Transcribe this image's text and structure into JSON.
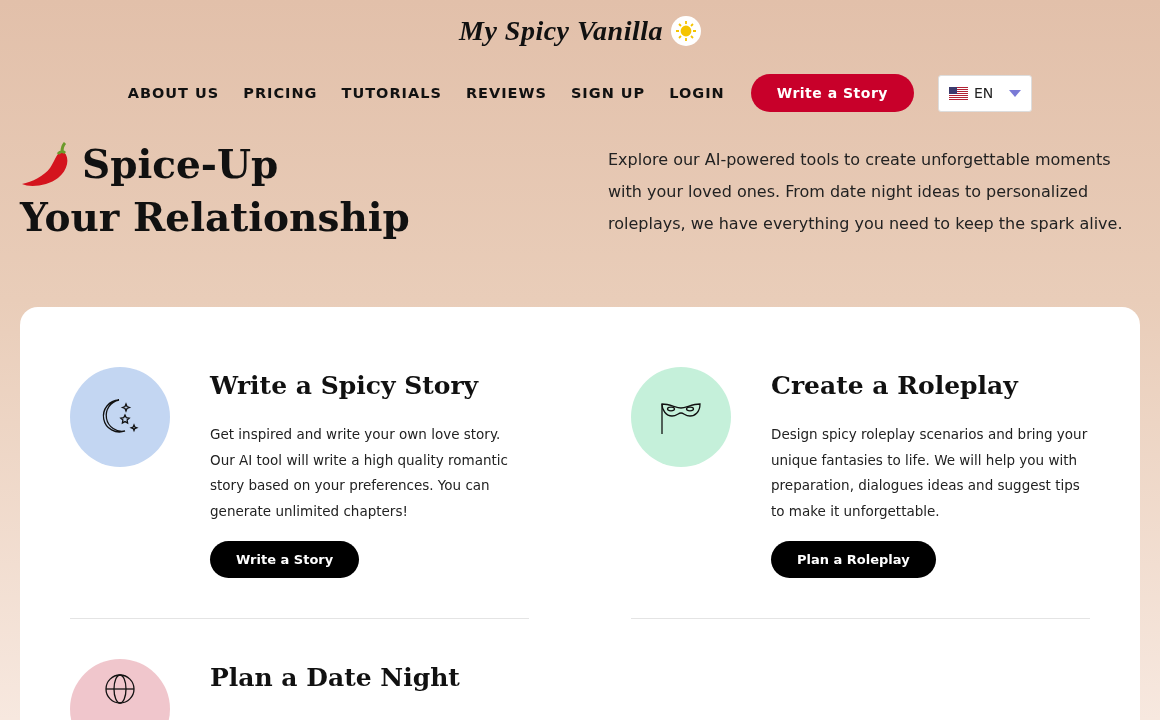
{
  "header": {
    "logo": "My Spicy Vanilla",
    "theme_toggle": {
      "on": false
    }
  },
  "nav": {
    "links": [
      "ABOUT US",
      "PRICING",
      "TUTORIALS",
      "REVIEWS",
      "SIGN UP",
      "LOGIN"
    ],
    "cta": "Write a Story",
    "language": "EN"
  },
  "hero": {
    "title_line_1": "Spice-Up",
    "title_line_2": "Your Relationship",
    "description": "Explore our AI-powered tools to create unforgettable moments with your loved ones. From date night ideas to personalized roleplays, we have everything you need to keep the spark alive."
  },
  "features": [
    {
      "kind": "moon",
      "color": "#c3d6f2",
      "title": "Write a Spicy Story",
      "description": "Get inspired and write your own love story. Our AI tool will write a high quality romantic story based on your preferences. You can generate unlimited chapters!",
      "button": "Write a Story"
    },
    {
      "kind": "mask",
      "color": "#c5f0da",
      "title": "Create a Roleplay",
      "description": "Design spicy roleplay scenarios and bring your unique fantasies to life. We will help you with preparation, dialogues ideas and suggest tips to make it unforgettable.",
      "button": "Plan a Roleplay"
    },
    {
      "kind": "globe",
      "color": "#f0c6cc",
      "title": "Plan a Date Night"
    }
  ]
}
